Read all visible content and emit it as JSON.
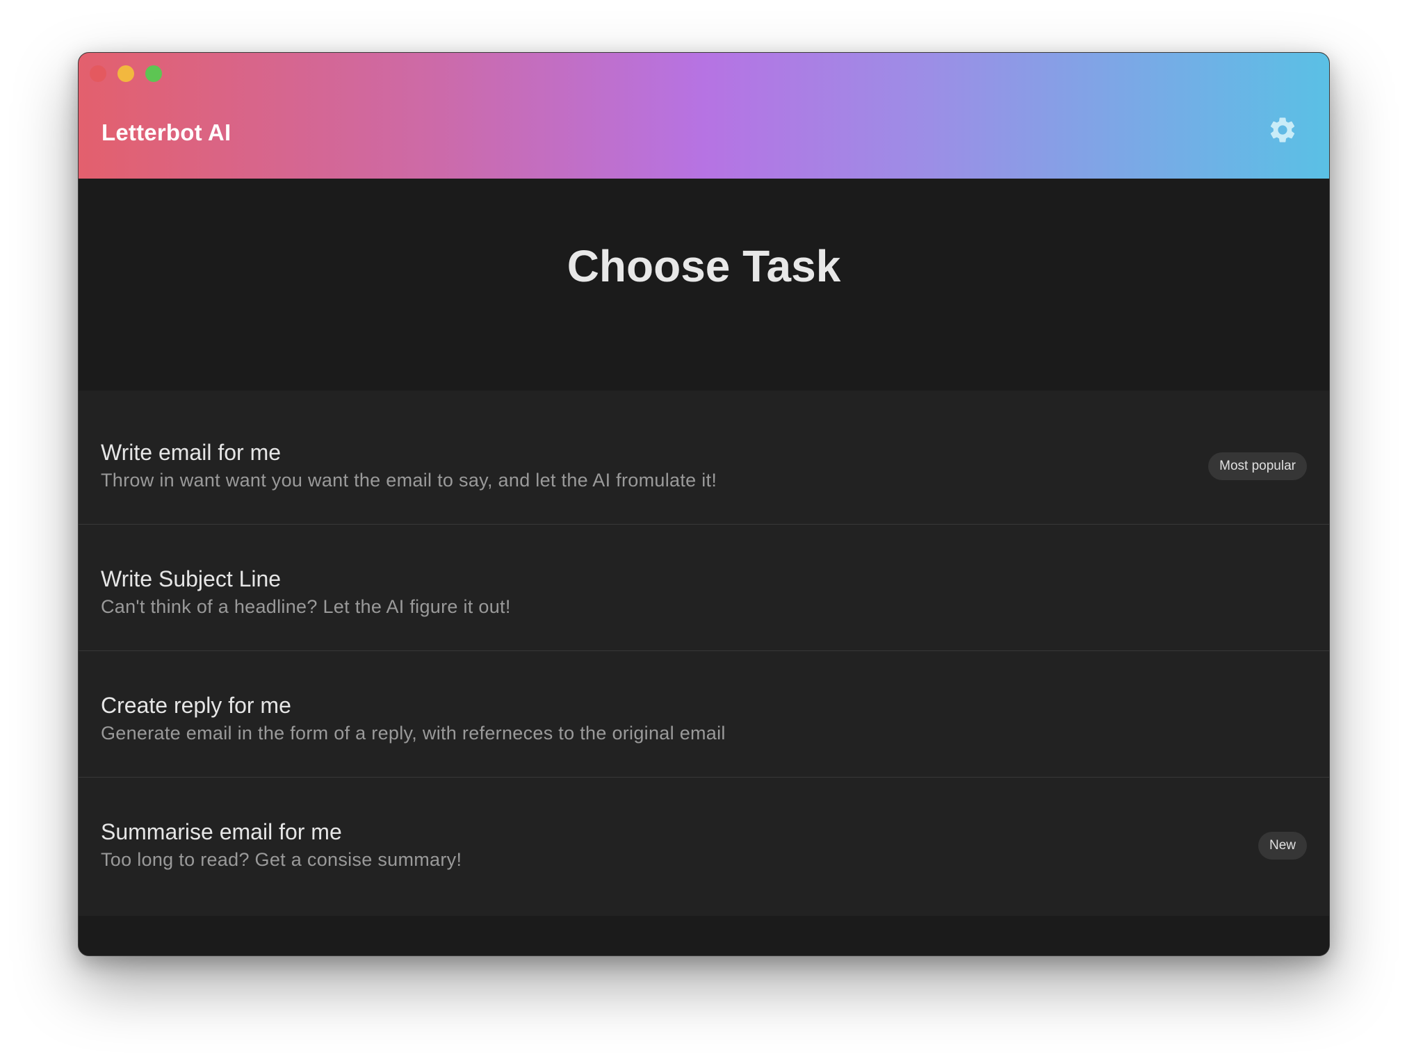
{
  "window": {
    "traffic_lights": {
      "close_color": "#e4595f",
      "minimize_color": "#f2b83f",
      "zoom_color": "#5dc553"
    }
  },
  "header": {
    "app_title": "Letterbot AI",
    "settings_icon": "gear-icon",
    "gradient_colors": [
      "#e3606d",
      "#b673e3",
      "#5ac0e5"
    ]
  },
  "main": {
    "page_title": "Choose Task"
  },
  "tasks": [
    {
      "title": "Write email for me",
      "description": "Throw in want want you want the email to say, and let the AI fromulate it!",
      "badge": "Most popular"
    },
    {
      "title": "Write Subject Line",
      "description": "Can't think of a headline? Let the AI figure it out!"
    },
    {
      "title": "Create reply for me",
      "description": "Generate email in the form of a reply, with referneces to the original email"
    },
    {
      "title": "Summarise email for me",
      "description": "Too long to read? Get a consise summary!",
      "badge": "New"
    }
  ]
}
